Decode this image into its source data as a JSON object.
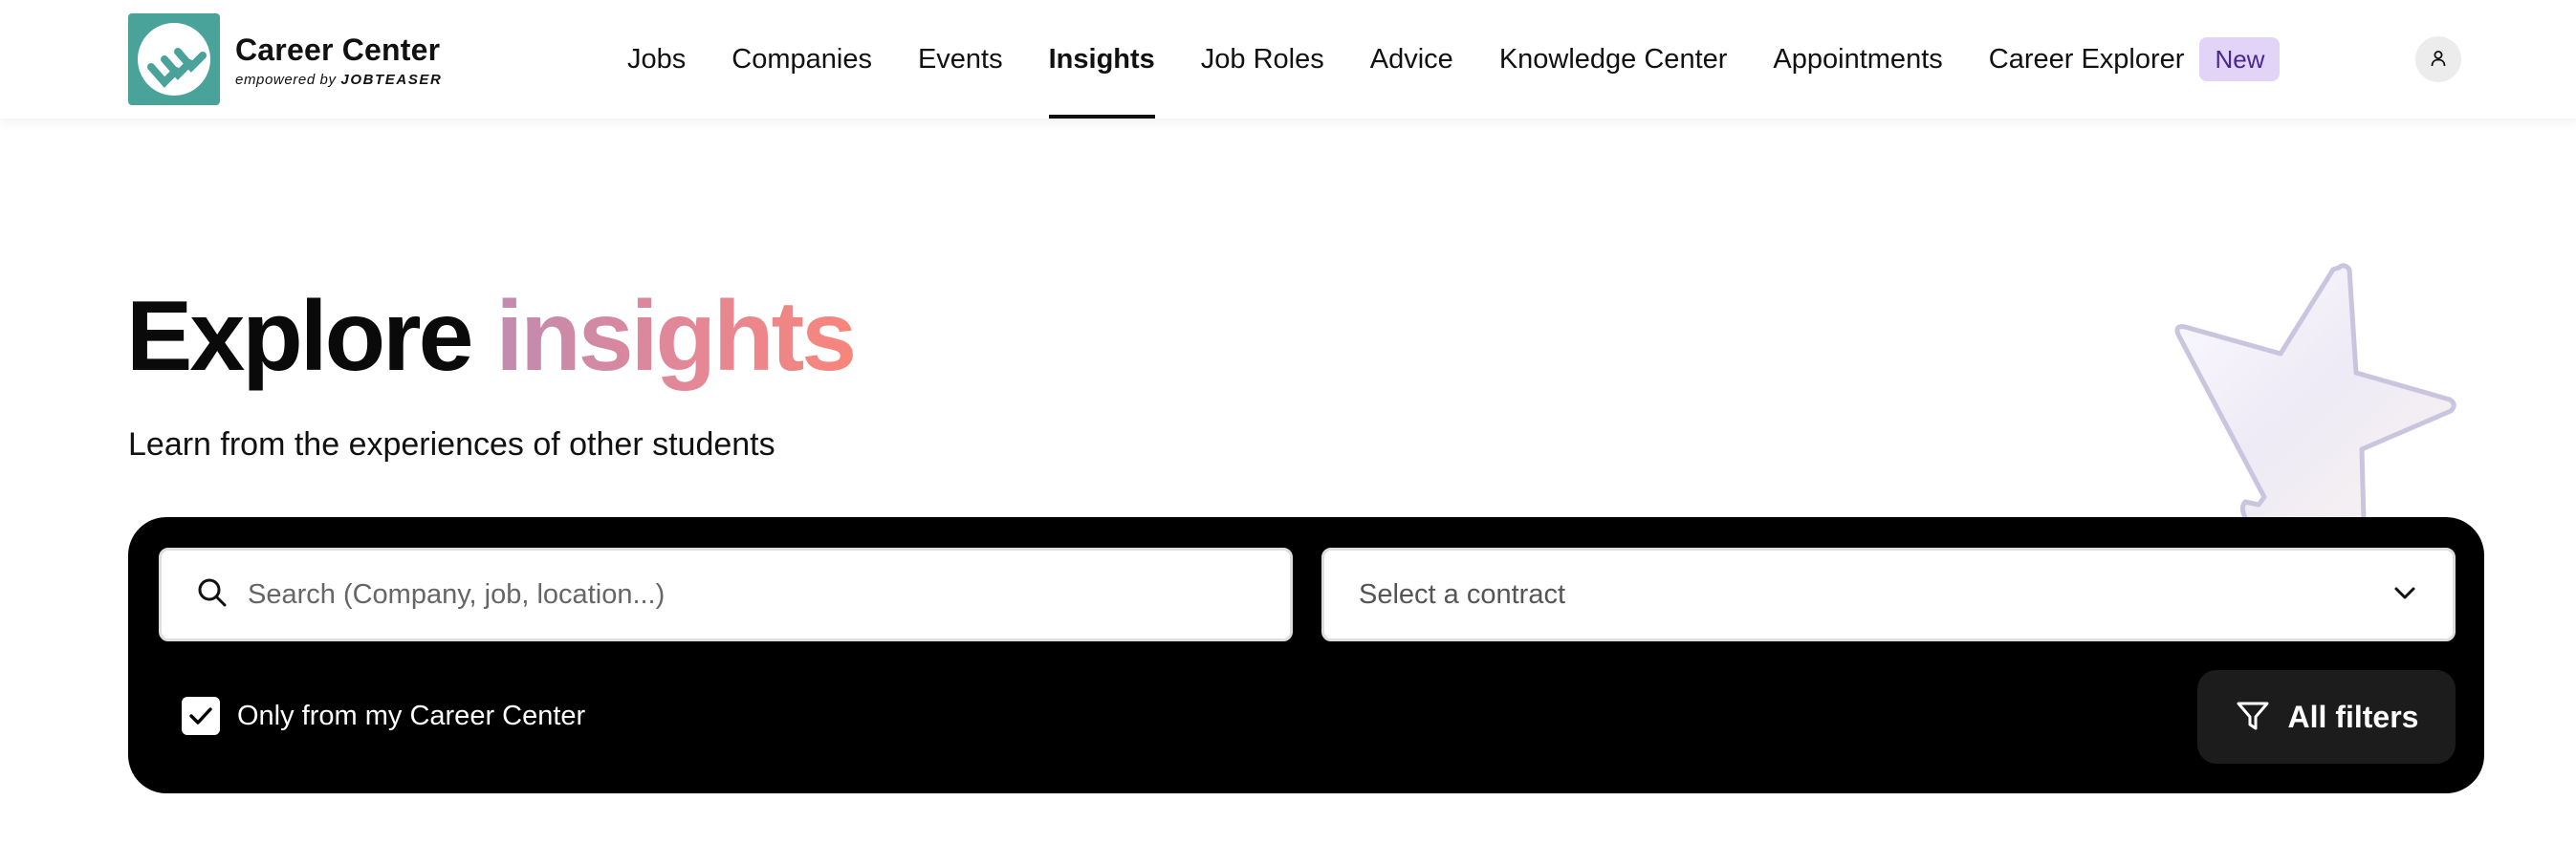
{
  "brand": {
    "title": "Career Center",
    "sub_prefix": "empowered by",
    "sub_brand": "JOBTEASER",
    "color": "#4aa39a"
  },
  "nav": {
    "items": [
      {
        "label": "Jobs",
        "active": false
      },
      {
        "label": "Companies",
        "active": false
      },
      {
        "label": "Events",
        "active": false
      },
      {
        "label": "Insights",
        "active": true
      },
      {
        "label": "Job Roles",
        "active": false
      },
      {
        "label": "Advice",
        "active": false
      },
      {
        "label": "Knowledge Center",
        "active": false
      },
      {
        "label": "Appointments",
        "active": false
      },
      {
        "label": "Career Explorer",
        "active": false
      }
    ],
    "new_badge": "New",
    "profile_icon": "user-icon"
  },
  "hero": {
    "title_main": "Explore",
    "title_accent": "insights",
    "subtitle": "Learn from the experiences of other students",
    "accent_gradient": [
      "#c08bb0",
      "#f7857a"
    ]
  },
  "search": {
    "placeholder": "Search (Company, job, location...)",
    "value": "",
    "icon": "search-icon"
  },
  "contract_select": {
    "label": "Select a contract",
    "icon": "chevron-down-icon"
  },
  "filters": {
    "only_my_career_center_label": "Only from my Career Center",
    "only_my_career_center_checked": true,
    "all_filters_label": "All filters",
    "icon": "filter-icon"
  },
  "colors": {
    "panel_background": "#000000",
    "active_underline": "#111111",
    "badge_background": "#e2d4f7",
    "badge_text": "#4b2591"
  }
}
